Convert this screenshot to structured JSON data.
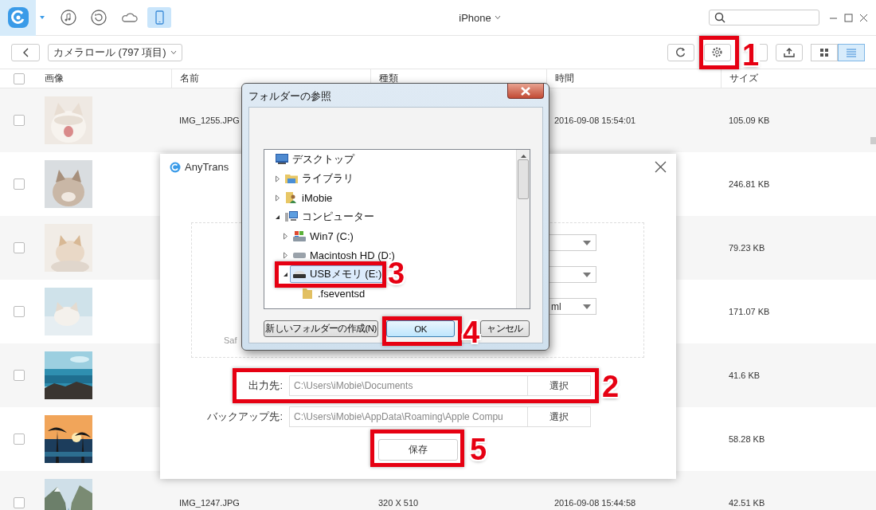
{
  "toolbar": {
    "nav_icons": [
      {
        "kind": "music",
        "selected": false
      },
      {
        "kind": "restore",
        "selected": false
      },
      {
        "kind": "cloud",
        "selected": false
      },
      {
        "kind": "device",
        "selected": true
      }
    ],
    "device_title": "iPhone"
  },
  "library_bar": {
    "album": "カメラロール (797 項目)",
    "buttons": [
      {
        "kind": "refresh"
      },
      {
        "kind": "settings"
      },
      {
        "kind": "blank"
      },
      {
        "kind": "export"
      },
      {
        "kind": "grid",
        "selected": false
      },
      {
        "kind": "list",
        "selected": true
      }
    ]
  },
  "table": {
    "select_all_checked": false,
    "columns": [
      "画像",
      "名前",
      "種類",
      "時間",
      "サイズ"
    ],
    "rows": [
      {
        "checked": false,
        "name": "IMG_1255.JPG",
        "time": "2016-09-08 15:54:01",
        "size": "105.09 KB"
      },
      {
        "checked": false,
        "size": "246.81 KB"
      },
      {
        "checked": false,
        "size": "79.23 KB"
      },
      {
        "checked": false,
        "size": "171.07 KB"
      },
      {
        "checked": false,
        "size": "41.6 KB"
      },
      {
        "checked": false,
        "size": "58.28 KB"
      },
      {
        "checked": false,
        "name": "IMG_1247.JPG",
        "type": "320 X 510",
        "time": "2016-09-08 15:44:58",
        "size": "42.51 KB"
      }
    ]
  },
  "settings_dialog": {
    "title": "AnyTrans",
    "dropdowns": [
      {
        "kind": "select"
      },
      {
        "kind": "select"
      },
      {
        "kind": "select",
        "value": "ml"
      }
    ],
    "label_fragment": "Saf",
    "paths": [
      {
        "label": "出力先:",
        "value": "C:\\Users\\iMobie\\Documents",
        "disabled": true,
        "button": "選択"
      },
      {
        "label": "バックアップ先:",
        "value": "C:\\Users\\iMobie\\AppData\\Roaming\\Apple Compu",
        "disabled": true,
        "button": "選択"
      }
    ],
    "save_button": "保存"
  },
  "folder_dialog": {
    "title": "フォルダーの参照",
    "tree": [
      {
        "label": "デスクトップ",
        "kind": "desktop",
        "selected": false,
        "children": [
          {
            "label": "ライブラリ",
            "kind": "library",
            "expanded": false,
            "selected": false
          },
          {
            "label": "iMobie",
            "kind": "user",
            "expanded": false,
            "selected": false
          },
          {
            "label": "コンピューター",
            "kind": "computer",
            "expanded": true,
            "selected": false,
            "children": [
              {
                "label": "Win7 (C:)",
                "kind": "system-drive",
                "expanded": false,
                "selected": false
              },
              {
                "label": "Macintosh HD (D:)",
                "kind": "drive",
                "expanded": false,
                "selected": false
              },
              {
                "label": "USBメモリ (E:)",
                "kind": "usb",
                "expanded": true,
                "selected": true,
                "children": [
                  {
                    "label": ".fseventsd",
                    "kind": "folder",
                    "selected": false
                  }
                ]
              }
            ]
          }
        ]
      }
    ],
    "buttons": [
      {
        "label": "新しいフォルダーの作成(N)",
        "focused": false
      },
      {
        "label": "OK",
        "focused": true
      },
      {
        "label": "ャンセル",
        "focused": false
      }
    ]
  },
  "annotations": [
    {
      "number": "1"
    },
    {
      "number": "2"
    },
    {
      "number": "3"
    },
    {
      "number": "4"
    },
    {
      "number": "5"
    }
  ]
}
